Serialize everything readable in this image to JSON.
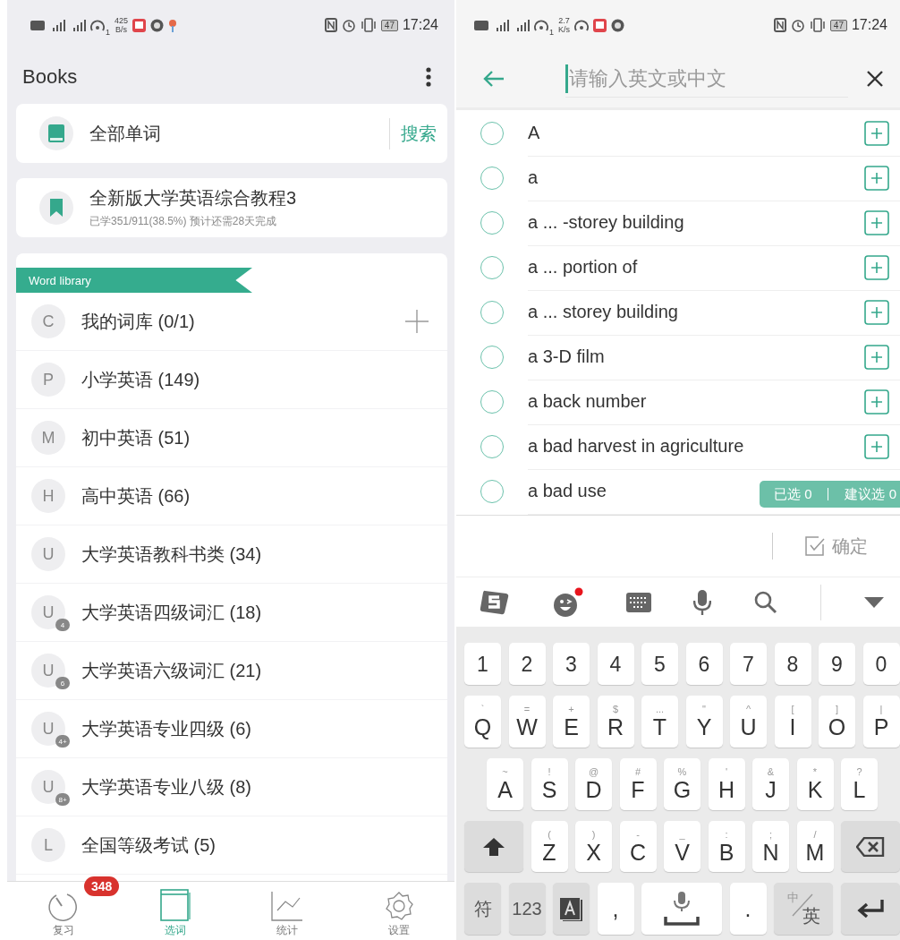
{
  "left": {
    "status_bar": {
      "sim_index": "1",
      "speed": "425",
      "speed_unit": "B/s",
      "battery": "47",
      "time": "17:24"
    },
    "title": "Books",
    "all_words": {
      "label": "全部单词",
      "search_button": "搜索"
    },
    "current_book": {
      "title": "全新版大学英语综合教程3",
      "progress": "已学351/911(38.5%) 预计还需28天完成"
    },
    "library": {
      "title": "Word library",
      "items": [
        {
          "letter": "C",
          "label": "我的词库 (0/1)",
          "addable": true
        },
        {
          "letter": "P",
          "label": "小学英语 (149)",
          "addable": false
        },
        {
          "letter": "M",
          "label": "初中英语 (51)",
          "addable": false
        },
        {
          "letter": "H",
          "label": "高中英语 (66)",
          "addable": false
        },
        {
          "letter": "U",
          "label": "大学英语教科书类 (34)",
          "addable": false
        },
        {
          "letter": "U",
          "level": "4",
          "label": "大学英语四级词汇 (18)",
          "addable": false
        },
        {
          "letter": "U",
          "level": "6",
          "label": "大学英语六级词汇 (21)",
          "addable": false
        },
        {
          "letter": "U",
          "level": "4+",
          "label": "大学英语专业四级 (6)",
          "addable": false
        },
        {
          "letter": "U",
          "level": "8+",
          "label": "大学英语专业八级 (8)",
          "addable": false
        },
        {
          "letter": "L",
          "label": "全国等级考试 (5)",
          "addable": false
        }
      ]
    },
    "bottom_nav": [
      {
        "label": "复习",
        "selected": false,
        "badge": "348"
      },
      {
        "label": "选词",
        "selected": true
      },
      {
        "label": "统计",
        "selected": false
      },
      {
        "label": "设置",
        "selected": false
      }
    ]
  },
  "right": {
    "status_bar": {
      "sim_index": "1",
      "speed": "2.7",
      "speed_unit": "K/s",
      "battery": "47",
      "time": "17:24"
    },
    "search": {
      "placeholder": "请输入英文或中文"
    },
    "words": [
      {
        "text": "A",
        "selected": false
      },
      {
        "text": "a",
        "selected": false
      },
      {
        "text": "a ... -storey building",
        "selected": false
      },
      {
        "text": "a ... portion of",
        "selected": false
      },
      {
        "text": "a ... storey building",
        "selected": false
      },
      {
        "text": "a 3-D film",
        "selected": false
      },
      {
        "text": "a back number",
        "selected": false
      },
      {
        "text": "a bad harvest in agriculture",
        "selected": false
      },
      {
        "text": "a bad use",
        "selected": false
      }
    ],
    "selection_badge": {
      "selected": "已选 0",
      "suggested": "建议选 0"
    },
    "confirm_button": "确定",
    "keyboard": {
      "number_row": [
        {
          "kind": "key",
          "label": "1"
        },
        {
          "kind": "key",
          "label": "2"
        },
        {
          "kind": "key",
          "label": "3"
        },
        {
          "kind": "key",
          "label": "4"
        },
        {
          "kind": "key",
          "label": "5"
        },
        {
          "kind": "key",
          "label": "6"
        },
        {
          "kind": "key",
          "label": "7"
        },
        {
          "kind": "key",
          "label": "8"
        },
        {
          "kind": "key",
          "label": "9"
        },
        {
          "kind": "key",
          "label": "0"
        }
      ],
      "letter_rows": [
        [
          {
            "kind": "key",
            "label": "Q",
            "hint": "`"
          },
          {
            "kind": "key",
            "label": "W",
            "hint": "="
          },
          {
            "kind": "key",
            "label": "E",
            "hint": "+"
          },
          {
            "kind": "key",
            "label": "R",
            "hint": "$"
          },
          {
            "kind": "key",
            "label": "T",
            "hint": "..."
          },
          {
            "kind": "key",
            "label": "Y",
            "hint": "\""
          },
          {
            "kind": "key",
            "label": "U",
            "hint": "^"
          },
          {
            "kind": "key",
            "label": "I",
            "hint": "["
          },
          {
            "kind": "key",
            "label": "O",
            "hint": "]"
          },
          {
            "kind": "key",
            "label": "P",
            "hint": "|"
          }
        ],
        [
          {
            "kind": "key",
            "label": "A",
            "hint": "~"
          },
          {
            "kind": "key",
            "label": "S",
            "hint": "!"
          },
          {
            "kind": "key",
            "label": "D",
            "hint": "@"
          },
          {
            "kind": "key",
            "label": "F",
            "hint": "#"
          },
          {
            "kind": "key",
            "label": "G",
            "hint": "%"
          },
          {
            "kind": "key",
            "label": "H",
            "hint": "'"
          },
          {
            "kind": "key",
            "label": "J",
            "hint": "&"
          },
          {
            "kind": "key",
            "label": "K",
            "hint": "*"
          },
          {
            "kind": "key",
            "label": "L",
            "hint": "?"
          }
        ],
        [
          {
            "kind": "shift"
          },
          {
            "kind": "key",
            "label": "Z",
            "hint": "("
          },
          {
            "kind": "key",
            "label": "X",
            "hint": ")"
          },
          {
            "kind": "key",
            "label": "C",
            "hint": "-"
          },
          {
            "kind": "key",
            "label": "V",
            "hint": "_"
          },
          {
            "kind": "key",
            "label": "B",
            "hint": ":"
          },
          {
            "kind": "key",
            "label": "N",
            "hint": ";"
          },
          {
            "kind": "key",
            "label": "M",
            "hint": "/"
          },
          {
            "kind": "backspace"
          }
        ]
      ],
      "function_row": [
        {
          "kind": "function",
          "label": "符"
        },
        {
          "kind": "function",
          "label": "123"
        },
        {
          "kind": "layout"
        },
        {
          "kind": "key",
          "label": ","
        },
        {
          "kind": "space"
        },
        {
          "kind": "key",
          "label": "."
        },
        {
          "kind": "language",
          "label": "中",
          "label_2": "英"
        },
        {
          "kind": "enter"
        }
      ]
    }
  }
}
